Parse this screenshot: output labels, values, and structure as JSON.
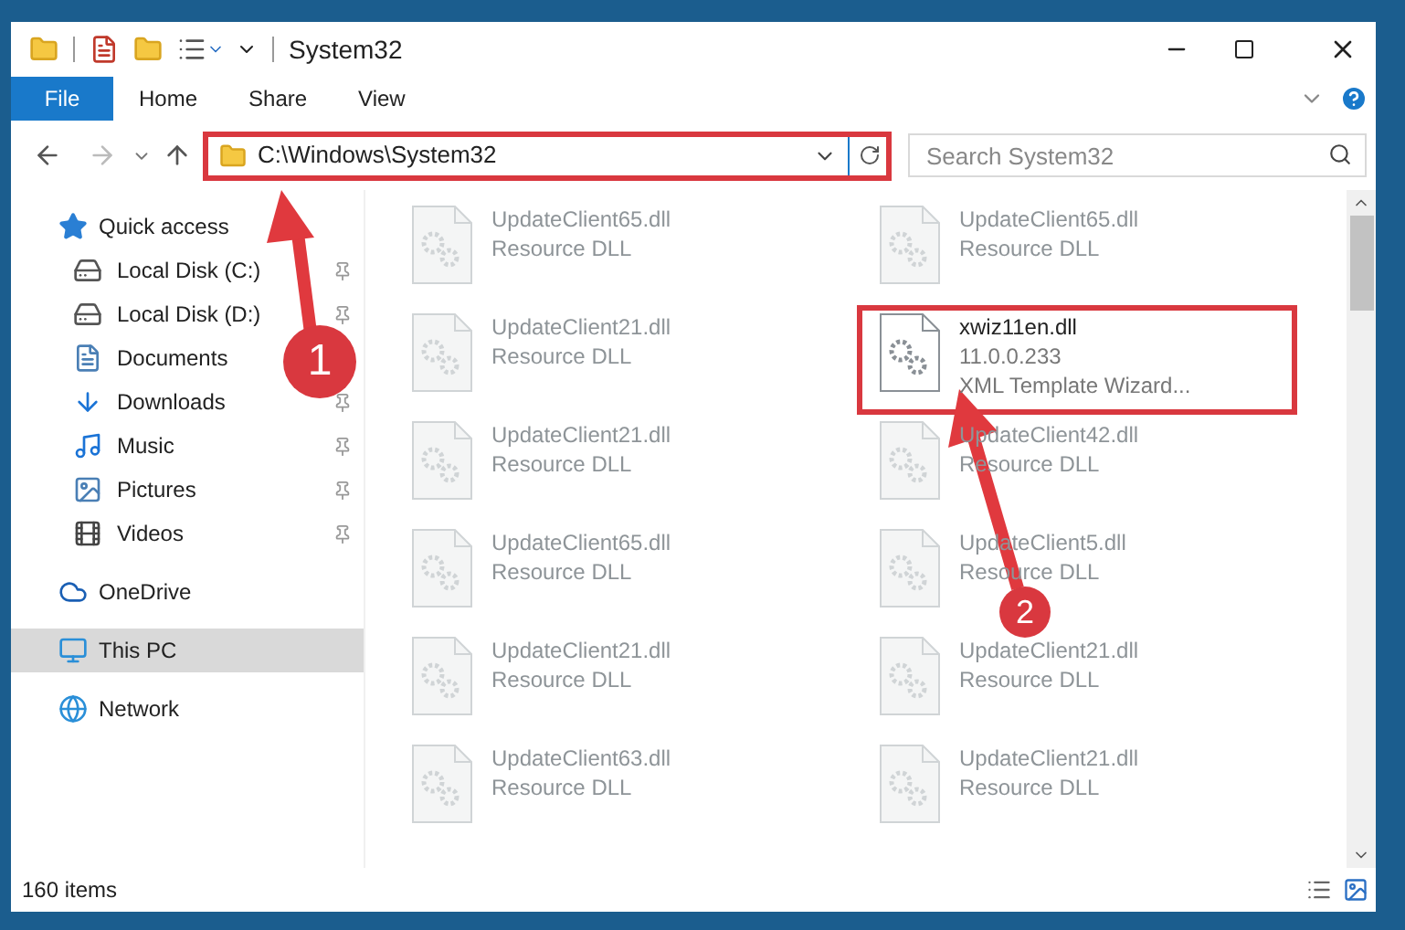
{
  "window": {
    "title": "System32"
  },
  "ribbon_tabs": [
    {
      "label": "File",
      "kind": "file-menu"
    },
    {
      "label": "Home",
      "kind": "tab"
    },
    {
      "label": "Share",
      "kind": "tab"
    },
    {
      "label": "View",
      "kind": "tab"
    }
  ],
  "address": {
    "path": "C:\\Windows\\System32"
  },
  "search": {
    "placeholder": "Search System32"
  },
  "navigation": [
    {
      "label": "Quick access",
      "selected": false,
      "children": [
        {
          "label": "Local Disk (C:)",
          "selected": false,
          "pinned": true
        },
        {
          "label": "Local Disk (D:)",
          "selected": false,
          "pinned": true
        },
        {
          "label": "Documents",
          "selected": false
        },
        {
          "label": "Downloads",
          "selected": false,
          "pinned": true
        },
        {
          "label": "Music",
          "selected": false,
          "pinned": true
        },
        {
          "label": "Pictures",
          "selected": false,
          "pinned": true
        },
        {
          "label": "Videos",
          "selected": false,
          "pinned": true
        }
      ]
    },
    {
      "label": "OneDrive",
      "selected": false
    },
    {
      "label": "This PC",
      "selected": true
    },
    {
      "label": "Network",
      "selected": false
    }
  ],
  "files": [
    {
      "name": "UpdateClient65.dll",
      "lines": [
        "Resource DLL"
      ],
      "faded": true
    },
    {
      "name": "UpdateClient65.dll",
      "lines": [
        "Resource DLL"
      ],
      "faded": true
    },
    {
      "name": "UpdateClient21.dll",
      "lines": [
        "Resource DLL"
      ],
      "faded": true
    },
    {
      "name": "xwiz11en.dll",
      "lines": [
        "11.0.0.233",
        "XML Template Wizard..."
      ],
      "faded": false
    },
    {
      "name": "UpdateClient21.dll",
      "lines": [
        "Resource DLL"
      ],
      "faded": true
    },
    {
      "name": "UpdateClient42.dll",
      "lines": [
        "Resource DLL"
      ],
      "faded": true
    },
    {
      "name": "UpdateClient65.dll",
      "lines": [
        "Resource DLL"
      ],
      "faded": true
    },
    {
      "name": "UpdateClient5.dll",
      "lines": [
        "Resource DLL"
      ],
      "faded": true
    },
    {
      "name": "UpdateClient21.dll",
      "lines": [
        "Resource DLL"
      ],
      "faded": true
    },
    {
      "name": "UpdateClient21.dll",
      "lines": [
        "Resource DLL"
      ],
      "faded": true
    },
    {
      "name": "UpdateClient63.dll",
      "lines": [
        "Resource DLL"
      ],
      "faded": true
    },
    {
      "name": "UpdateClient21.dll",
      "lines": [
        "Resource DLL"
      ],
      "faded": true
    }
  ],
  "status_bar": {
    "item_count": "160 items"
  },
  "annotations": [
    {
      "label": "1"
    },
    {
      "label": "2"
    }
  ]
}
